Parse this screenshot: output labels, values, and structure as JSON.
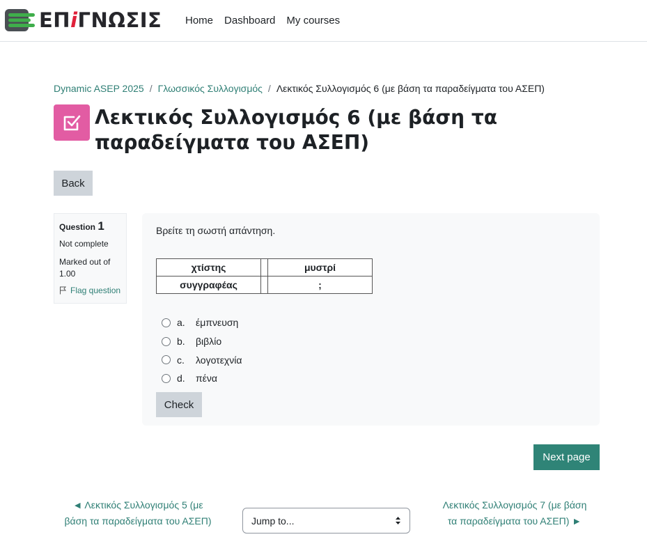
{
  "brand": {
    "logo_text_1": "ΕΠ",
    "logo_text_2": "i",
    "logo_text_3": "ΓΝΩΣΙΣ"
  },
  "nav": {
    "items": [
      "Home",
      "Dashboard",
      "My courses"
    ]
  },
  "breadcrumb": {
    "items": [
      "Dynamic ASEP 2025",
      "Γλωσσικός Συλλογισμός"
    ],
    "current": "Λεκτικός Συλλογισμός 6 (με βάση τα παραδείγματα του ΑΣΕΠ)"
  },
  "page": {
    "title": "Λεκτικός Συλλογισμός 6 (με βάση τα παραδείγματα του ΑΣΕΠ)",
    "back_label": "Back"
  },
  "question_info": {
    "label": "Question",
    "number": "1",
    "state": "Not complete",
    "grade": "Marked out of 1.00",
    "flag_label": "Flag question"
  },
  "question": {
    "text": "Βρείτε τη σωστή απάντηση.",
    "table": [
      [
        "χτίστης",
        "",
        "μυστρί"
      ],
      [
        "συγγραφέας",
        "",
        ";"
      ]
    ],
    "answers": [
      {
        "letter": "a.",
        "text": "έμπνευση"
      },
      {
        "letter": "b.",
        "text": "βιβλίο"
      },
      {
        "letter": "c.",
        "text": "λογοτεχνία"
      },
      {
        "letter": "d.",
        "text": "πένα"
      }
    ],
    "check_label": "Check"
  },
  "navigation": {
    "next_page_label": "Next page",
    "prev_activity": "◄ Λεκτικός Συλλογισμός 5 (με βάση τα παραδείγματα του ΑΣΕΠ)",
    "next_activity": "Λεκτικός Συλλογισμός 7 (με βάση τα παραδείγματα του ΑΣΕΠ) ►",
    "jump_placeholder": "Jump to..."
  },
  "colors": {
    "accent": "#2f8477",
    "link": "#2f7f75",
    "quiz_icon": "#e25ca3",
    "button_secondary": "#ced4da"
  }
}
